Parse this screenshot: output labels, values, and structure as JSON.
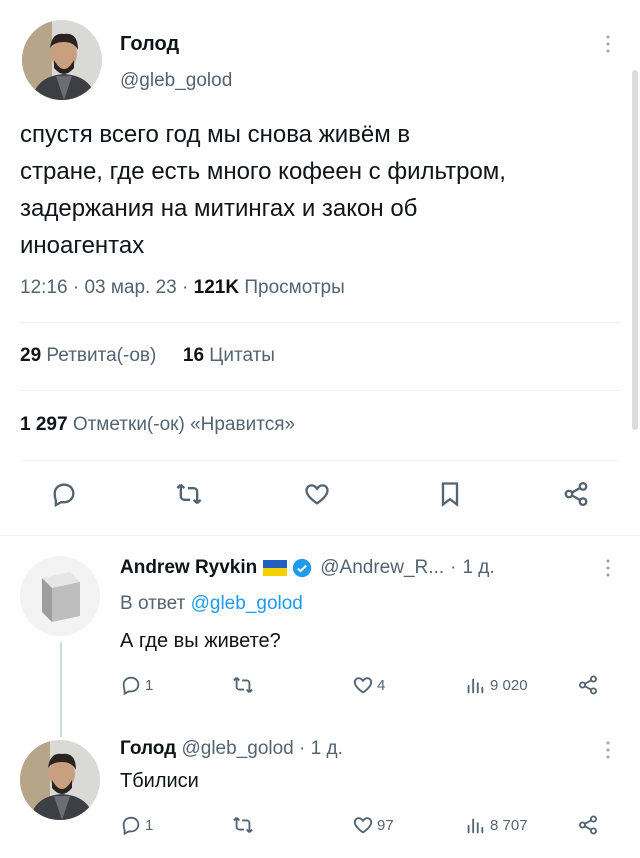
{
  "main_tweet": {
    "author_name": "Голод",
    "handle": "@gleb_golod",
    "text_lines": [
      "спустя всего год мы снова живём в",
      "стране, где есть много кофеен с фильтром,",
      "задержания на митингах и закон об",
      "иноагентах"
    ],
    "time": "12:16",
    "date": "03 мар. 23",
    "views_count": "121K",
    "views_label": "Просмотры",
    "retweets_count": "29",
    "retweets_label": "Ретвита(-ов)",
    "quotes_count": "16",
    "quotes_label": "Цитаты",
    "likes_count": "1 297",
    "likes_label": "Отметки(-ок) «Нравится»"
  },
  "reply1": {
    "author_name": "Andrew Ryvkin",
    "handle": "@Andrew_R...",
    "age": "1 д.",
    "reply_to_prefix": "В ответ",
    "reply_to_handle": "@gleb_golod",
    "text": "А где вы живете?",
    "replies": "1",
    "retweets": "",
    "likes": "4",
    "views": "9 020"
  },
  "reply2": {
    "author_name": "Голод",
    "handle": "@gleb_golod",
    "age": "1 д.",
    "text": "Тбилиси",
    "replies": "1",
    "retweets": "",
    "likes": "97",
    "views": "8 707"
  },
  "colors": {
    "accent": "#1d9bf0",
    "muted": "#536471",
    "verified": "#1d9bf0",
    "flag_blue": "#1f5fbf",
    "flag_yellow": "#f5d000"
  },
  "icons": [
    "more-icon",
    "reply-icon",
    "retweet-icon",
    "like-icon",
    "bookmark-icon",
    "share-icon",
    "views-icon",
    "verified-icon",
    "flag-ukraine-icon"
  ]
}
